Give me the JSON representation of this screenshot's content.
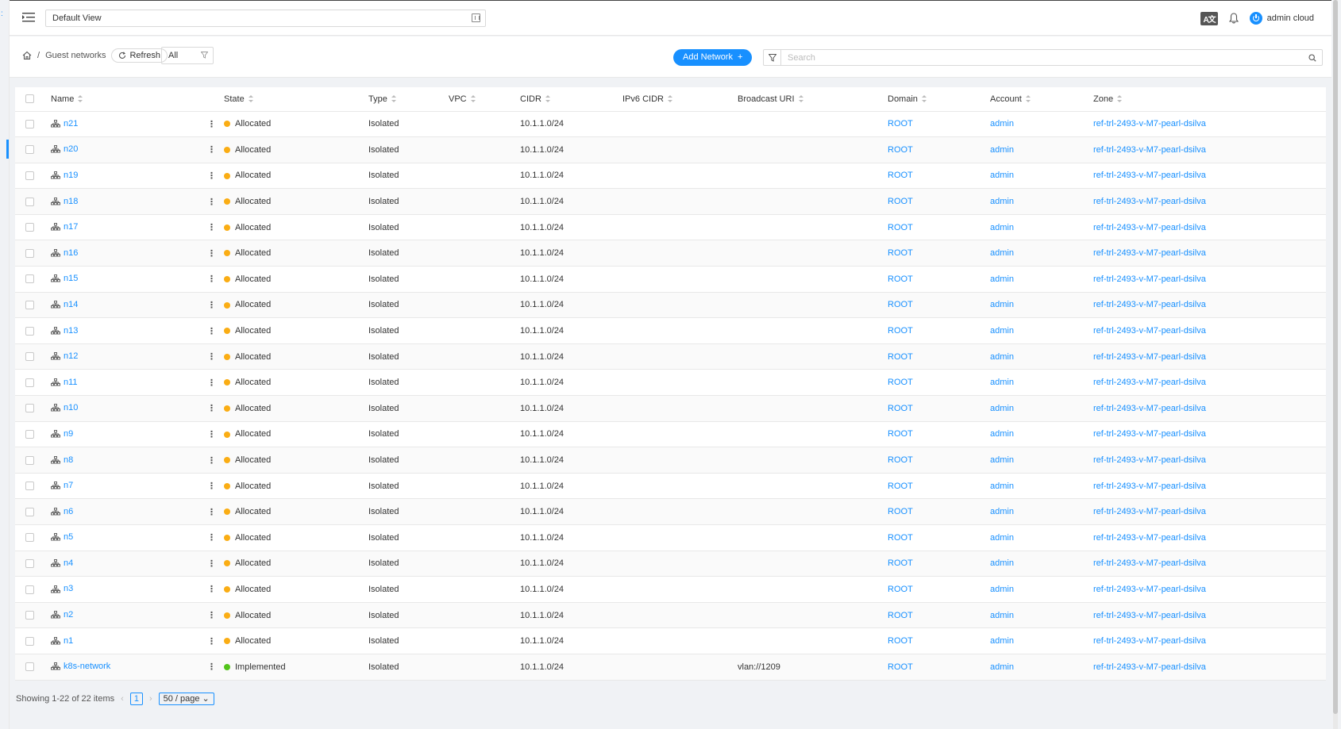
{
  "header": {
    "view_select": "Default View",
    "lang_label": "A文",
    "user_name": "admin cloud"
  },
  "toolbar": {
    "breadcrumb_section": "Guest networks",
    "refresh_label": "Refresh",
    "filter_value": "All",
    "add_label": "Add Network",
    "search_placeholder": "Search"
  },
  "table": {
    "columns": [
      "Name",
      "State",
      "Type",
      "VPC",
      "CIDR",
      "IPv6 CIDR",
      "Broadcast URI",
      "Domain",
      "Account",
      "Zone"
    ],
    "rows": [
      {
        "name": "n21",
        "state": "Allocated",
        "type": "Isolated",
        "vpc": "",
        "cidr": "10.1.1.0/24",
        "ipv6": "",
        "broadcast": "",
        "domain": "ROOT",
        "account": "admin",
        "zone": "ref-trl-2493-v-M7-pearl-dsilva"
      },
      {
        "name": "n20",
        "state": "Allocated",
        "type": "Isolated",
        "vpc": "",
        "cidr": "10.1.1.0/24",
        "ipv6": "",
        "broadcast": "",
        "domain": "ROOT",
        "account": "admin",
        "zone": "ref-trl-2493-v-M7-pearl-dsilva"
      },
      {
        "name": "n19",
        "state": "Allocated",
        "type": "Isolated",
        "vpc": "",
        "cidr": "10.1.1.0/24",
        "ipv6": "",
        "broadcast": "",
        "domain": "ROOT",
        "account": "admin",
        "zone": "ref-trl-2493-v-M7-pearl-dsilva"
      },
      {
        "name": "n18",
        "state": "Allocated",
        "type": "Isolated",
        "vpc": "",
        "cidr": "10.1.1.0/24",
        "ipv6": "",
        "broadcast": "",
        "domain": "ROOT",
        "account": "admin",
        "zone": "ref-trl-2493-v-M7-pearl-dsilva"
      },
      {
        "name": "n17",
        "state": "Allocated",
        "type": "Isolated",
        "vpc": "",
        "cidr": "10.1.1.0/24",
        "ipv6": "",
        "broadcast": "",
        "domain": "ROOT",
        "account": "admin",
        "zone": "ref-trl-2493-v-M7-pearl-dsilva"
      },
      {
        "name": "n16",
        "state": "Allocated",
        "type": "Isolated",
        "vpc": "",
        "cidr": "10.1.1.0/24",
        "ipv6": "",
        "broadcast": "",
        "domain": "ROOT",
        "account": "admin",
        "zone": "ref-trl-2493-v-M7-pearl-dsilva"
      },
      {
        "name": "n15",
        "state": "Allocated",
        "type": "Isolated",
        "vpc": "",
        "cidr": "10.1.1.0/24",
        "ipv6": "",
        "broadcast": "",
        "domain": "ROOT",
        "account": "admin",
        "zone": "ref-trl-2493-v-M7-pearl-dsilva"
      },
      {
        "name": "n14",
        "state": "Allocated",
        "type": "Isolated",
        "vpc": "",
        "cidr": "10.1.1.0/24",
        "ipv6": "",
        "broadcast": "",
        "domain": "ROOT",
        "account": "admin",
        "zone": "ref-trl-2493-v-M7-pearl-dsilva"
      },
      {
        "name": "n13",
        "state": "Allocated",
        "type": "Isolated",
        "vpc": "",
        "cidr": "10.1.1.0/24",
        "ipv6": "",
        "broadcast": "",
        "domain": "ROOT",
        "account": "admin",
        "zone": "ref-trl-2493-v-M7-pearl-dsilva"
      },
      {
        "name": "n12",
        "state": "Allocated",
        "type": "Isolated",
        "vpc": "",
        "cidr": "10.1.1.0/24",
        "ipv6": "",
        "broadcast": "",
        "domain": "ROOT",
        "account": "admin",
        "zone": "ref-trl-2493-v-M7-pearl-dsilva"
      },
      {
        "name": "n11",
        "state": "Allocated",
        "type": "Isolated",
        "vpc": "",
        "cidr": "10.1.1.0/24",
        "ipv6": "",
        "broadcast": "",
        "domain": "ROOT",
        "account": "admin",
        "zone": "ref-trl-2493-v-M7-pearl-dsilva"
      },
      {
        "name": "n10",
        "state": "Allocated",
        "type": "Isolated",
        "vpc": "",
        "cidr": "10.1.1.0/24",
        "ipv6": "",
        "broadcast": "",
        "domain": "ROOT",
        "account": "admin",
        "zone": "ref-trl-2493-v-M7-pearl-dsilva"
      },
      {
        "name": "n9",
        "state": "Allocated",
        "type": "Isolated",
        "vpc": "",
        "cidr": "10.1.1.0/24",
        "ipv6": "",
        "broadcast": "",
        "domain": "ROOT",
        "account": "admin",
        "zone": "ref-trl-2493-v-M7-pearl-dsilva"
      },
      {
        "name": "n8",
        "state": "Allocated",
        "type": "Isolated",
        "vpc": "",
        "cidr": "10.1.1.0/24",
        "ipv6": "",
        "broadcast": "",
        "domain": "ROOT",
        "account": "admin",
        "zone": "ref-trl-2493-v-M7-pearl-dsilva"
      },
      {
        "name": "n7",
        "state": "Allocated",
        "type": "Isolated",
        "vpc": "",
        "cidr": "10.1.1.0/24",
        "ipv6": "",
        "broadcast": "",
        "domain": "ROOT",
        "account": "admin",
        "zone": "ref-trl-2493-v-M7-pearl-dsilva"
      },
      {
        "name": "n6",
        "state": "Allocated",
        "type": "Isolated",
        "vpc": "",
        "cidr": "10.1.1.0/24",
        "ipv6": "",
        "broadcast": "",
        "domain": "ROOT",
        "account": "admin",
        "zone": "ref-trl-2493-v-M7-pearl-dsilva"
      },
      {
        "name": "n5",
        "state": "Allocated",
        "type": "Isolated",
        "vpc": "",
        "cidr": "10.1.1.0/24",
        "ipv6": "",
        "broadcast": "",
        "domain": "ROOT",
        "account": "admin",
        "zone": "ref-trl-2493-v-M7-pearl-dsilva"
      },
      {
        "name": "n4",
        "state": "Allocated",
        "type": "Isolated",
        "vpc": "",
        "cidr": "10.1.1.0/24",
        "ipv6": "",
        "broadcast": "",
        "domain": "ROOT",
        "account": "admin",
        "zone": "ref-trl-2493-v-M7-pearl-dsilva"
      },
      {
        "name": "n3",
        "state": "Allocated",
        "type": "Isolated",
        "vpc": "",
        "cidr": "10.1.1.0/24",
        "ipv6": "",
        "broadcast": "",
        "domain": "ROOT",
        "account": "admin",
        "zone": "ref-trl-2493-v-M7-pearl-dsilva"
      },
      {
        "name": "n2",
        "state": "Allocated",
        "type": "Isolated",
        "vpc": "",
        "cidr": "10.1.1.0/24",
        "ipv6": "",
        "broadcast": "",
        "domain": "ROOT",
        "account": "admin",
        "zone": "ref-trl-2493-v-M7-pearl-dsilva"
      },
      {
        "name": "n1",
        "state": "Allocated",
        "type": "Isolated",
        "vpc": "",
        "cidr": "10.1.1.0/24",
        "ipv6": "",
        "broadcast": "",
        "domain": "ROOT",
        "account": "admin",
        "zone": "ref-trl-2493-v-M7-pearl-dsilva"
      },
      {
        "name": "k8s-network",
        "state": "Implemented",
        "type": "Isolated",
        "vpc": "",
        "cidr": "10.1.1.0/24",
        "ipv6": "",
        "broadcast": "vlan://1209",
        "domain": "ROOT",
        "account": "admin",
        "zone": "ref-trl-2493-v-M7-pearl-dsilva"
      }
    ]
  },
  "status_colors": {
    "Allocated": "#faad14",
    "Implemented": "#52c41a"
  },
  "accent_color": "#1890ff",
  "pagination": {
    "summary": "Showing 1-22 of 22 items",
    "current_page": "1",
    "page_size": "50 / page"
  }
}
